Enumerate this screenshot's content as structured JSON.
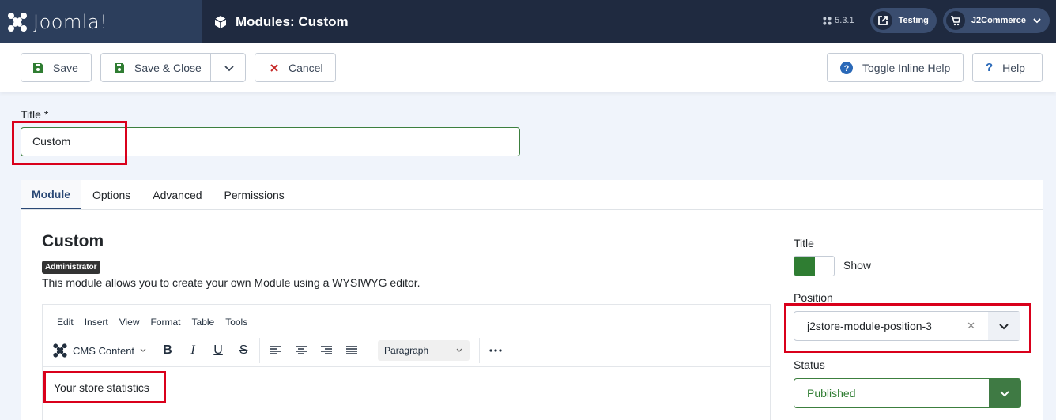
{
  "header": {
    "brand": "Joomla!",
    "page_title": "Modules: Custom",
    "version": "5.3.1",
    "site_link_label": "Testing",
    "user_menu_label": "J2Commerce"
  },
  "toolbar": {
    "save_label": "Save",
    "save_close_label": "Save & Close",
    "cancel_label": "Cancel",
    "inline_help_label": "Toggle Inline Help",
    "help_label": "Help"
  },
  "form": {
    "title_label": "Title *",
    "title_value": "Custom"
  },
  "tabs": [
    {
      "label": "Module"
    },
    {
      "label": "Options"
    },
    {
      "label": "Advanced"
    },
    {
      "label": "Permissions"
    }
  ],
  "module": {
    "heading": "Custom",
    "badge": "Administrator",
    "description": "This module allows you to create your own Module using a WYSIWYG editor."
  },
  "editor": {
    "menu": [
      "Edit",
      "Insert",
      "View",
      "Format",
      "Table",
      "Tools"
    ],
    "cms_content_label": "CMS Content",
    "format_select": "Paragraph",
    "content": "Your store statistics"
  },
  "sidebar": {
    "title_label": "Title",
    "title_toggle_label": "Show",
    "position_label": "Position",
    "position_value": "j2store-module-position-3",
    "status_label": "Status",
    "status_value": "Published"
  },
  "colors": {
    "header_bg": "#1f2a40",
    "accent_green": "#2f7d32",
    "highlight_red": "#d9001b",
    "tab_active": "#2a4875"
  }
}
